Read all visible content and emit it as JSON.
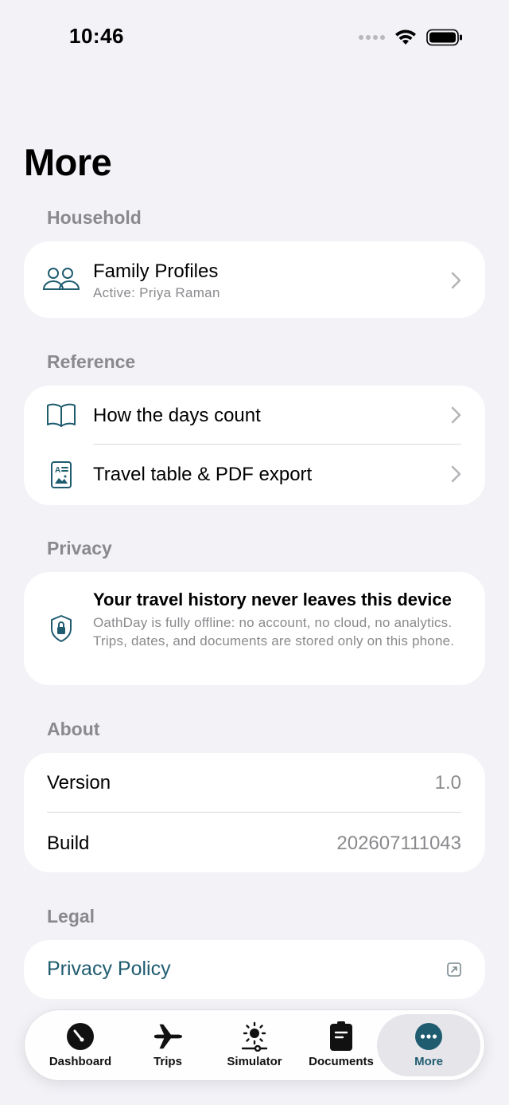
{
  "status_bar": {
    "time": "10:46"
  },
  "page": {
    "title": "More"
  },
  "sections": {
    "household": {
      "label": "Household",
      "family_profiles": {
        "title": "Family Profiles",
        "subtitle": "Active: Priya Raman"
      }
    },
    "reference": {
      "label": "Reference",
      "items": [
        {
          "title": "How the days count"
        },
        {
          "title": "Travel table & PDF export"
        }
      ]
    },
    "privacy": {
      "label": "Privacy",
      "title": "Your travel history never leaves this device",
      "body": "OathDay is fully offline: no account, no cloud, no analytics. Trips, dates, and documents are stored only on this phone."
    },
    "about": {
      "label": "About",
      "version_label": "Version",
      "version_value": "1.0",
      "build_label": "Build",
      "build_value": "202607111043"
    },
    "legal": {
      "label": "Legal",
      "privacy_policy": "Privacy Policy"
    }
  },
  "tabbar": {
    "tabs": [
      {
        "label": "Dashboard",
        "icon": "gauge-icon"
      },
      {
        "label": "Trips",
        "icon": "airplane-icon"
      },
      {
        "label": "Simulator",
        "icon": "sun-slider-icon"
      },
      {
        "label": "Documents",
        "icon": "document-icon"
      },
      {
        "label": "More",
        "icon": "ellipsis-circle-icon",
        "active": true
      }
    ]
  },
  "colors": {
    "accent": "#1F5C70",
    "background": "#F2F2F7",
    "card": "#FFFFFF",
    "secondary_text": "#8A8A8E"
  }
}
